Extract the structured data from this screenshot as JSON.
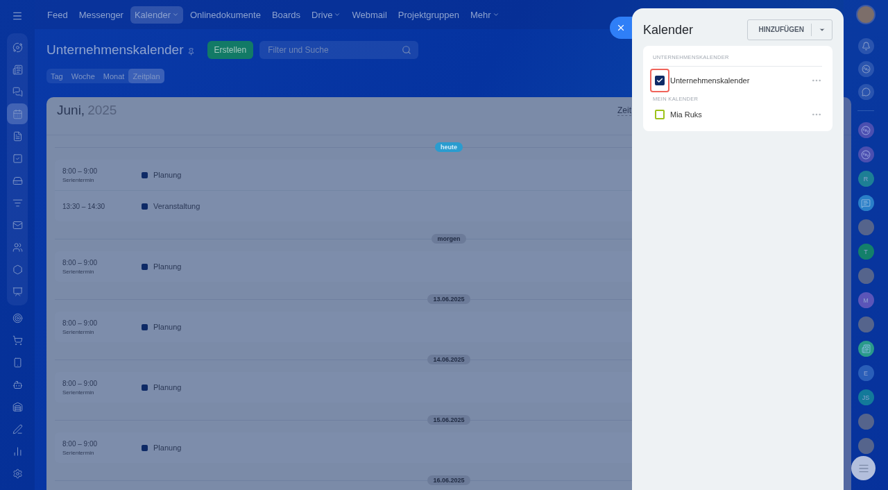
{
  "top_nav": {
    "items": [
      {
        "label": "Feed",
        "selected": false,
        "dropdown": false
      },
      {
        "label": "Messenger",
        "selected": false,
        "dropdown": false
      },
      {
        "label": "Kalender",
        "selected": true,
        "dropdown": true
      },
      {
        "label": "Onlinedokumente",
        "selected": false,
        "dropdown": false
      },
      {
        "label": "Boards",
        "selected": false,
        "dropdown": false
      },
      {
        "label": "Drive",
        "selected": false,
        "dropdown": true
      },
      {
        "label": "Webmail",
        "selected": false,
        "dropdown": false
      },
      {
        "label": "Projektgruppen",
        "selected": false,
        "dropdown": false
      },
      {
        "label": "Mehr",
        "selected": false,
        "dropdown": true
      }
    ]
  },
  "left_sidebar": {
    "items": [
      {
        "selected": false
      },
      {
        "selected": false
      },
      {
        "selected": false
      },
      {
        "selected": true
      },
      {
        "selected": false
      },
      {
        "selected": false
      },
      {
        "selected": false
      },
      {
        "selected": false
      },
      {
        "selected": false
      },
      {
        "selected": false
      },
      {
        "selected": false
      },
      {
        "selected": false
      },
      {
        "selected": false
      },
      {
        "selected": false
      },
      {
        "selected": false
      },
      {
        "selected": false
      },
      {
        "selected": false
      },
      {
        "selected": false
      },
      {
        "selected": false
      },
      {
        "selected": false
      }
    ]
  },
  "page": {
    "title": "Unternehmenskalender",
    "create_button": "Erstellen",
    "search": {
      "placeholder": "Filter und Suche"
    },
    "view_tabs": [
      {
        "label": "Tag",
        "selected": false
      },
      {
        "label": "Woche",
        "selected": false
      },
      {
        "label": "Monat",
        "selected": false
      },
      {
        "label": "Zeitplan",
        "selected": true
      }
    ]
  },
  "schedule": {
    "month": "Juni,",
    "year": "2025",
    "header_right": "Zeit",
    "days": [
      {
        "label": "heute",
        "today": true,
        "events": [
          {
            "time": "8:00 – 9:00",
            "note": "Serientermin",
            "title": "Planung"
          },
          {
            "time": "13:30 – 14:30",
            "title": "Veranstaltung"
          }
        ]
      },
      {
        "label": "morgen",
        "today": false,
        "events": [
          {
            "time": "8:00 – 9:00",
            "note": "Serientermin",
            "title": "Planung"
          }
        ]
      },
      {
        "label": "13.06.2025",
        "today": false,
        "events": [
          {
            "time": "8:00 – 9:00",
            "note": "Serientermin",
            "title": "Planung"
          }
        ]
      },
      {
        "label": "14.06.2025",
        "today": false,
        "events": [
          {
            "time": "8:00 – 9:00",
            "note": "Serientermin",
            "title": "Planung"
          }
        ]
      },
      {
        "label": "15.06.2025",
        "today": false,
        "events": [
          {
            "time": "8:00 – 9:00",
            "note": "Serientermin",
            "title": "Planung"
          }
        ]
      },
      {
        "label": "16.06.2025",
        "today": false
      }
    ]
  },
  "calendar_panel": {
    "title": "Kalender",
    "add_button": "HINZUFÜGEN",
    "sections": [
      {
        "heading": "UNTERNEHMENSKALENDER",
        "calendars": [
          {
            "name": "Unternehmenskalender",
            "checked": true,
            "highlighted": true,
            "color": "#0e2a66"
          }
        ]
      },
      {
        "heading": "MEIN KALENDER",
        "calendars": [
          {
            "name": "Mia Ruks",
            "checked": false,
            "highlighted": false,
            "color": "#9dc21a"
          }
        ]
      }
    ]
  },
  "right_rail": {
    "contacts": [
      {
        "kind": "app"
      },
      {
        "kind": "app"
      },
      {
        "kind": "initials",
        "initials": "R",
        "color": "#1d7f95"
      },
      {
        "kind": "chat"
      },
      {
        "kind": "photo"
      },
      {
        "kind": "initials",
        "initials": "T",
        "color": "#13806a"
      },
      {
        "kind": "photo"
      },
      {
        "kind": "initials",
        "initials": "M",
        "color": "#5b55b8"
      },
      {
        "kind": "photo"
      },
      {
        "kind": "news"
      },
      {
        "kind": "initials",
        "initials": "E",
        "color": "#2a5eb8"
      },
      {
        "kind": "initials",
        "initials": "JS",
        "color": "#137a9a"
      },
      {
        "kind": "photo"
      },
      {
        "kind": "photo"
      }
    ]
  }
}
